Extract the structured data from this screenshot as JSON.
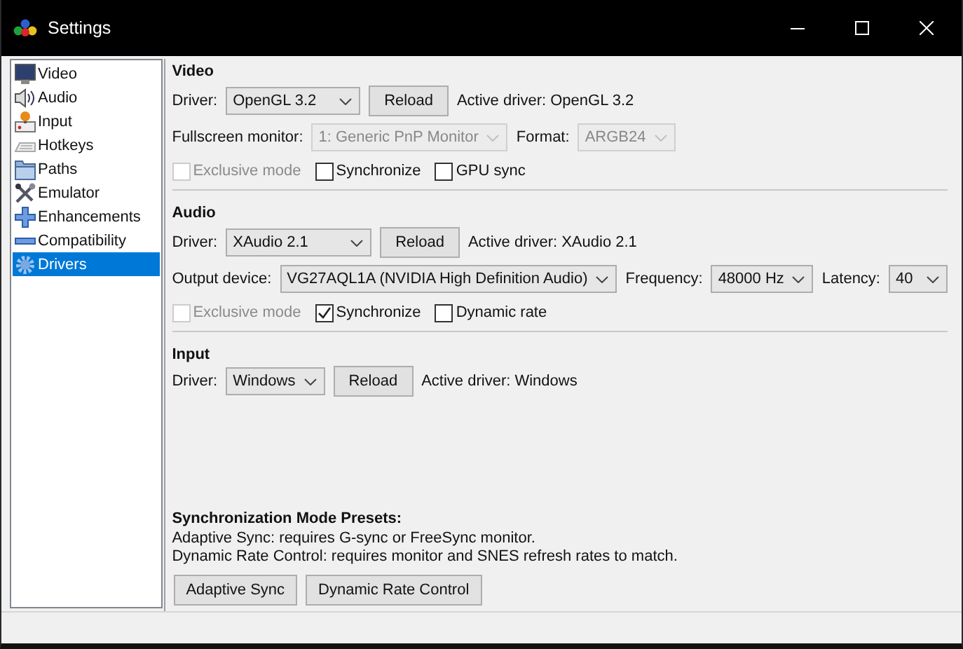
{
  "window": {
    "title": "Settings"
  },
  "sidebar": {
    "items": [
      {
        "label": "Video",
        "selected": false
      },
      {
        "label": "Audio",
        "selected": false
      },
      {
        "label": "Input",
        "selected": false
      },
      {
        "label": "Hotkeys",
        "selected": false
      },
      {
        "label": "Paths",
        "selected": false
      },
      {
        "label": "Emulator",
        "selected": false
      },
      {
        "label": "Enhancements",
        "selected": false
      },
      {
        "label": "Compatibility",
        "selected": false
      },
      {
        "label": "Drivers",
        "selected": true
      }
    ]
  },
  "sections": [
    {
      "title": "Video",
      "rows": [
        {
          "controls": [
            {
              "kind": "label",
              "text": "Driver:"
            },
            {
              "kind": "select",
              "value": "OpenGL 3.2",
              "disabled": false
            },
            {
              "kind": "button",
              "text": "Reload"
            },
            {
              "kind": "text",
              "text": "Active driver: OpenGL 3.2"
            }
          ]
        },
        {
          "controls": [
            {
              "kind": "label",
              "text": "Fullscreen monitor:"
            },
            {
              "kind": "select",
              "value": "1: Generic PnP Monitor",
              "disabled": true
            },
            {
              "kind": "label",
              "text": "Format:"
            },
            {
              "kind": "select",
              "value": "ARGB24",
              "disabled": true
            }
          ]
        },
        {
          "controls": [
            {
              "kind": "checkbox",
              "text": "Exclusive mode",
              "checked": false,
              "disabled": true
            },
            {
              "kind": "checkbox",
              "text": "Synchronize",
              "checked": false,
              "disabled": false
            },
            {
              "kind": "checkbox",
              "text": "GPU sync",
              "checked": false,
              "disabled": false
            }
          ]
        }
      ]
    },
    {
      "title": "Audio",
      "rows": [
        {
          "controls": [
            {
              "kind": "label",
              "text": "Driver:"
            },
            {
              "kind": "select",
              "value": "XAudio 2.1",
              "disabled": false
            },
            {
              "kind": "button",
              "text": "Reload"
            },
            {
              "kind": "text",
              "text": "Active driver: XAudio 2.1"
            }
          ]
        },
        {
          "controls": [
            {
              "kind": "label",
              "text": "Output device:"
            },
            {
              "kind": "select",
              "value": "VG27AQL1A (NVIDIA High Definition Audio)",
              "disabled": false
            },
            {
              "kind": "label",
              "text": "Frequency:"
            },
            {
              "kind": "select",
              "value": "48000 Hz",
              "disabled": false
            },
            {
              "kind": "label",
              "text": "Latency:"
            },
            {
              "kind": "select",
              "value": "40",
              "disabled": false
            }
          ]
        },
        {
          "controls": [
            {
              "kind": "checkbox",
              "text": "Exclusive mode",
              "checked": false,
              "disabled": true
            },
            {
              "kind": "checkbox",
              "text": "Synchronize",
              "checked": true,
              "disabled": false
            },
            {
              "kind": "checkbox",
              "text": "Dynamic rate",
              "checked": false,
              "disabled": false
            }
          ]
        }
      ]
    },
    {
      "title": "Input",
      "rows": [
        {
          "controls": [
            {
              "kind": "label",
              "text": "Driver:"
            },
            {
              "kind": "select",
              "value": "Windows",
              "disabled": false
            },
            {
              "kind": "button",
              "text": "Reload"
            },
            {
              "kind": "text",
              "text": "Active driver: Windows"
            }
          ]
        }
      ]
    }
  ],
  "presets": {
    "title": "Synchronization Mode Presets:",
    "lines": [
      "Adaptive Sync: requires G-sync or FreeSync monitor.",
      "Dynamic Rate Control: requires monitor and SNES refresh rates to match."
    ],
    "buttons": [
      "Adaptive Sync",
      "Dynamic Rate Control"
    ]
  }
}
